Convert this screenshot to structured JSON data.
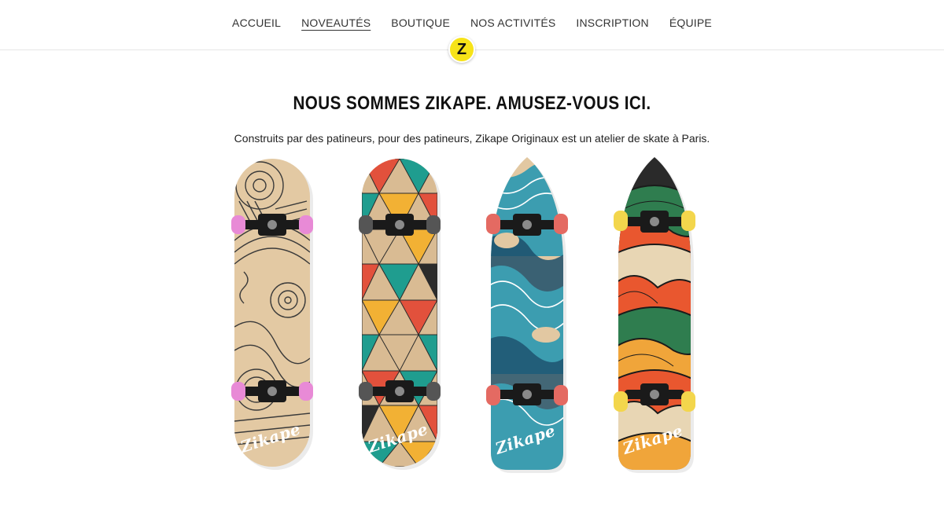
{
  "nav": {
    "items": [
      {
        "label": "ACCUEIL",
        "active": false
      },
      {
        "label": "NOVEAUTÉS",
        "active": true
      },
      {
        "label": "BOUTIQUE",
        "active": false
      },
      {
        "label": "NOS ACTIVITÉS",
        "active": false
      },
      {
        "label": "INSCRIPTION",
        "active": false
      },
      {
        "label": "ÉQUIPE",
        "active": false
      }
    ]
  },
  "logo": {
    "letter": "Z",
    "color": "#f7e318"
  },
  "hero": {
    "title": "NOUS SOMMES ZIKAPE. AMUSEZ-VOUS ICI.",
    "subtitle": "Construits par des patineurs, pour des patineurs, Zikape Originaux est un atelier de skate à Paris."
  },
  "boards": [
    {
      "brand": "Zikape",
      "deck_color": "#e3c9a3",
      "wheel_color": "#e88ad6",
      "colors": [
        "#3a3a3a"
      ]
    },
    {
      "brand": "Zikape",
      "deck_color": "#d9bb93",
      "wheel_color": "#555555",
      "colors": [
        "#1f9d8f",
        "#e2513c",
        "#f2b134",
        "#2b2b2b"
      ]
    },
    {
      "brand": "Zikape",
      "deck_color": "#e2c8a2",
      "wheel_color": "#e46a62",
      "colors": [
        "#3c9db0",
        "#1c4f6b",
        "#ffffff"
      ]
    },
    {
      "brand": "Zikape",
      "deck_color": "#2a2a2a",
      "wheel_color": "#f3d64c",
      "colors": [
        "#2f7d4f",
        "#e9572f",
        "#f0a53a",
        "#e8d6b4"
      ]
    }
  ]
}
